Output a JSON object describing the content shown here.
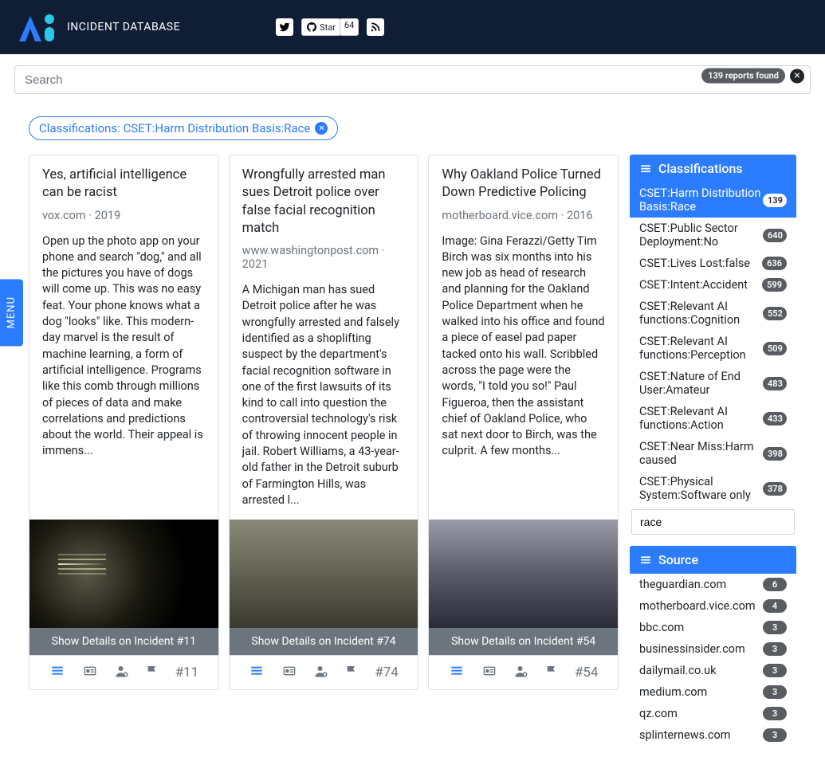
{
  "header": {
    "brand": "INCIDENT DATABASE",
    "github_star_label": "Star",
    "github_star_count": "64"
  },
  "search": {
    "placeholder": "Search",
    "result_count": "139 reports found"
  },
  "active_filter": {
    "label": "Classifications: CSET:Harm Distribution Basis:Race"
  },
  "cards": [
    {
      "title": "Yes, artificial intelligence can be racist",
      "source": "vox.com",
      "year": "2019",
      "excerpt": "Open up the photo app on your phone and search \"dog,\" and all the pictures you have of dogs will come up. This was no easy feat. Your phone knows what a dog \"looks\" like. This modern-day marvel is the result of machine learning, a form of artificial intelligence. Programs like this comb through millions of pieces of data and make correlations and predictions about the world. Their appeal is immens...",
      "incident_id": "11",
      "show_details": "Show Details on Incident #11"
    },
    {
      "title": "Wrongfully arrested man sues Detroit police over false facial recognition match",
      "source": "www.washingtonpost.com",
      "year": "2021",
      "excerpt": "A Michigan man has sued Detroit police after he was wrongfully arrested and falsely identified as a shoplifting suspect by the department's facial recognition software in one of the first lawsuits of its kind to call into question the controversial technology's risk of throwing innocent people in jail. Robert Williams, a 43-year-old father in the Detroit suburb of Farmington Hills, was arrested l...",
      "incident_id": "74",
      "show_details": "Show Details on Incident #74"
    },
    {
      "title": "Why Oakland Police Turned Down Predictive Policing",
      "source": "motherboard.vice.com",
      "year": "2016",
      "excerpt": "Image: Gina Ferazzi/Getty Tim Birch was six months into his new job as head of research and planning for the Oakland Police Department when he walked into his office and found a piece of easel pad paper tacked onto his wall. Scribbled across the page were the words, \"I told you so!\" Paul Figueroa, then the assistant chief of Oakland Police, who sat next door to Birch, was the culprit. A few months...",
      "incident_id": "54",
      "show_details": "Show Details on Incident #54"
    }
  ],
  "facets": {
    "classifications": {
      "title": "Classifications",
      "search_value": "race",
      "items": [
        {
          "label": "CSET:Harm Distribution Basis:Race",
          "count": "139",
          "selected": true
        },
        {
          "label": "CSET:Public Sector Deployment:No",
          "count": "640",
          "selected": false
        },
        {
          "label": "CSET:Lives Lost:false",
          "count": "636",
          "selected": false
        },
        {
          "label": "CSET:Intent:Accident",
          "count": "599",
          "selected": false
        },
        {
          "label": "CSET:Relevant AI functions:Cognition",
          "count": "552",
          "selected": false
        },
        {
          "label": "CSET:Relevant AI functions:Perception",
          "count": "509",
          "selected": false
        },
        {
          "label": "CSET:Nature of End User:Amateur",
          "count": "483",
          "selected": false
        },
        {
          "label": "CSET:Relevant AI functions:Action",
          "count": "433",
          "selected": false
        },
        {
          "label": "CSET:Near Miss:Harm caused",
          "count": "398",
          "selected": false
        },
        {
          "label": "CSET:Physical System:Software only",
          "count": "378",
          "selected": false
        }
      ]
    },
    "source": {
      "title": "Source",
      "items": [
        {
          "label": "theguardian.com",
          "count": "6"
        },
        {
          "label": "motherboard.vice.com",
          "count": "4"
        },
        {
          "label": "bbc.com",
          "count": "3"
        },
        {
          "label": "businessinsider.com",
          "count": "3"
        },
        {
          "label": "dailymail.co.uk",
          "count": "3"
        },
        {
          "label": "medium.com",
          "count": "3"
        },
        {
          "label": "qz.com",
          "count": "3"
        },
        {
          "label": "splinternews.com",
          "count": "3"
        }
      ]
    }
  },
  "menu_tab": "MENU"
}
